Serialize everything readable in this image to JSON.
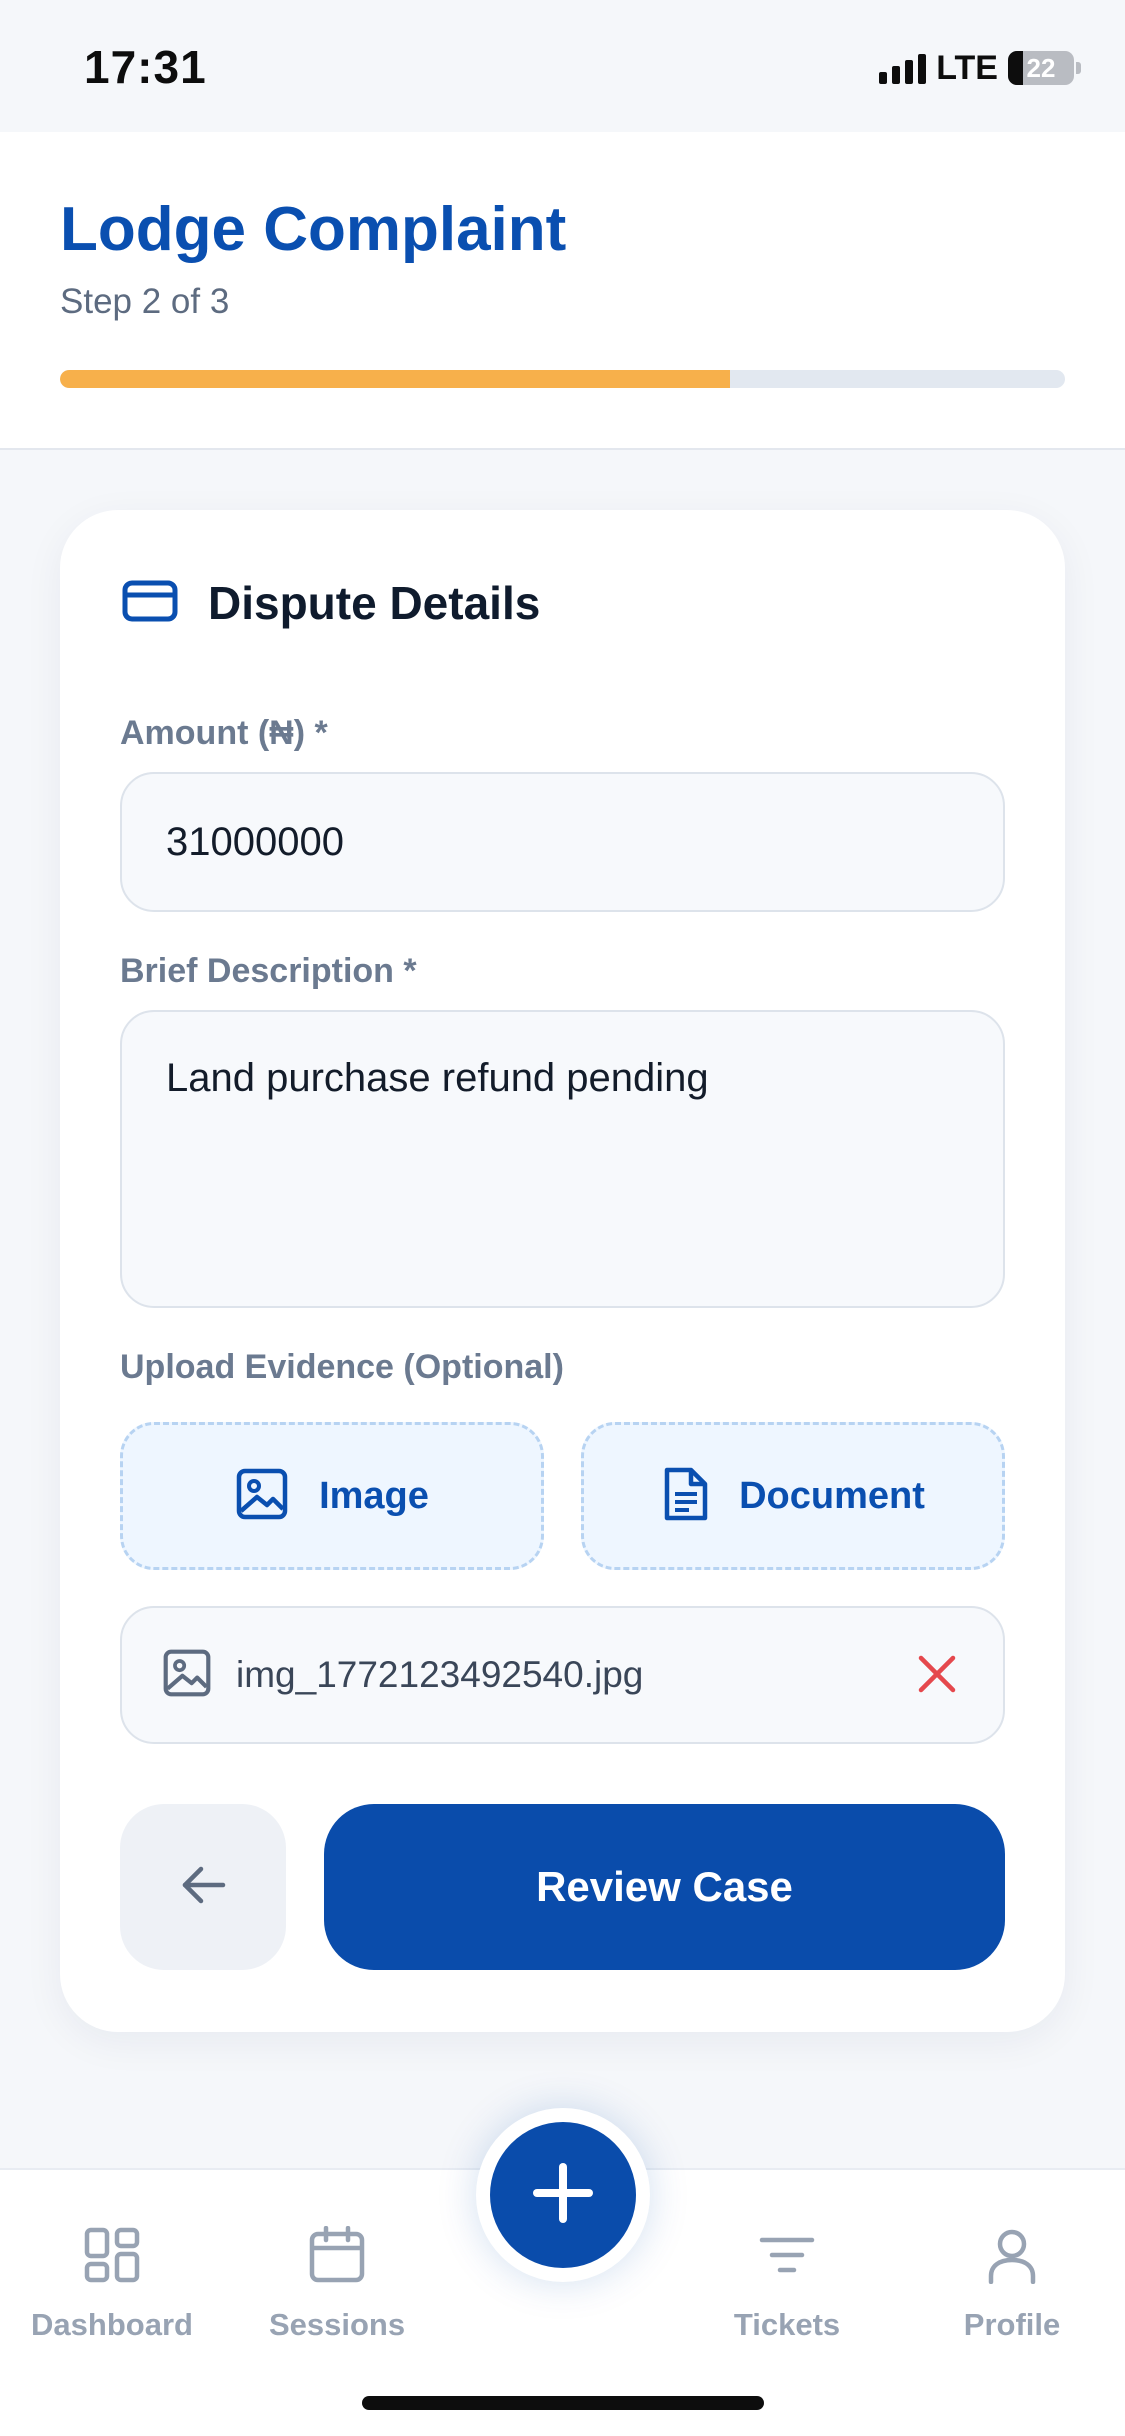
{
  "status_bar": {
    "time": "17:31",
    "network": "LTE",
    "battery_level": "22",
    "battery_fraction": 0.22
  },
  "header": {
    "title": "Lodge Complaint",
    "step": "Step 2 of 3",
    "progress_fraction": 0.667,
    "progress_color": "#f7b04b"
  },
  "card": {
    "icon": "credit-card-icon",
    "title": "Dispute Details",
    "amount_label": "Amount (₦) *",
    "amount_value": "31000000",
    "description_label": "Brief Description *",
    "description_value": "Land purchase refund pending",
    "upload_label": "Upload Evidence (Optional)",
    "upload_image_label": "Image",
    "upload_document_label": "Document",
    "attached_file": "img_1772123492540.jpg",
    "review_button": "Review Case"
  },
  "nav": {
    "items": [
      {
        "label": "Dashboard",
        "icon": "dashboard-icon"
      },
      {
        "label": "Sessions",
        "icon": "calendar-icon"
      },
      {
        "label": "Tickets",
        "icon": "filter-icon"
      },
      {
        "label": "Profile",
        "icon": "user-icon"
      }
    ],
    "fab_icon": "plus-icon"
  },
  "colors": {
    "brand_blue": "#0a4cab",
    "title_blue": "#0a4fb0",
    "accent_orange": "#f7b04b",
    "remove_red": "#e5484d",
    "nav_inactive": "#98a3b3"
  }
}
